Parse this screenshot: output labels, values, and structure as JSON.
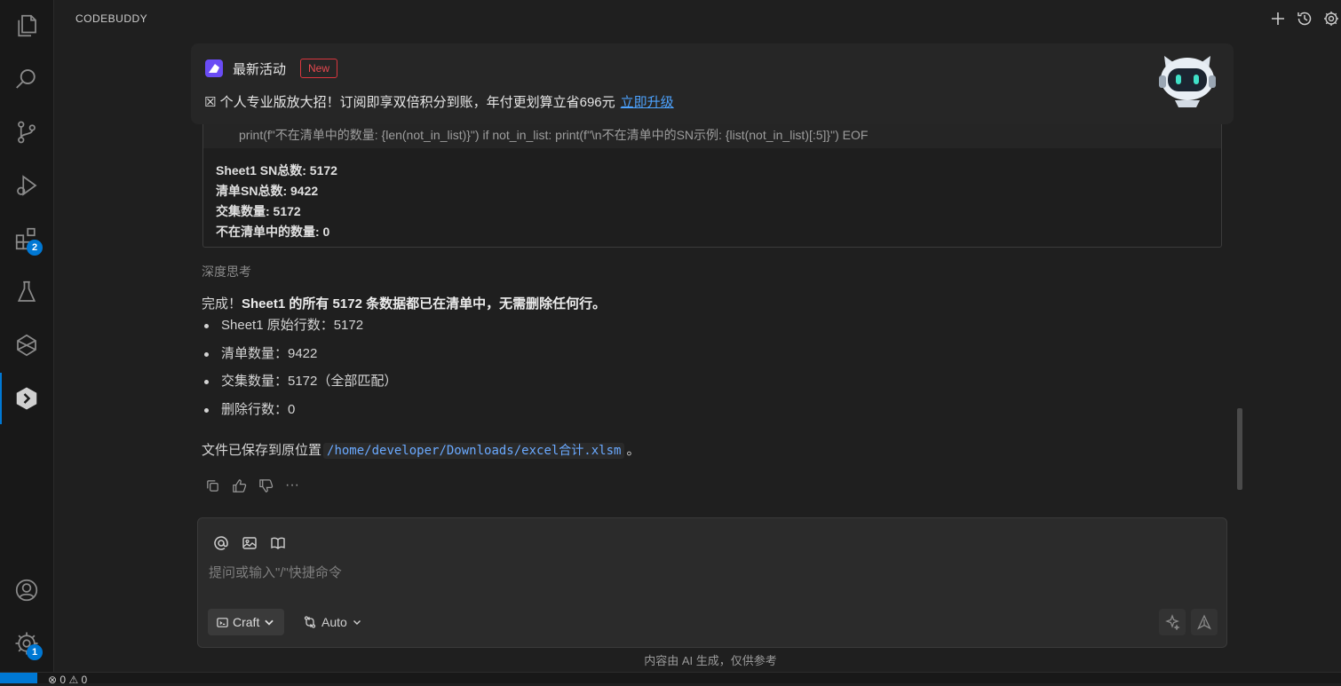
{
  "activity_bar": {
    "extensions_badge": "2",
    "settings_badge": "1"
  },
  "panel": {
    "title": "CODEBUDDY"
  },
  "promo": {
    "title": "最新活动",
    "badge": "New",
    "text": "☒ 个人专业版放大招！订阅即享双倍积分到账，年付更划算立省696元",
    "link": "立即升级"
  },
  "output": {
    "code_line": "print(f\"不在清单中的数量: {len(not_in_list)}\") if not_in_list: print(f\"\\n不在清单中的SN示例: {list(not_in_list)[:5]}\") EOF",
    "lines": [
      "Sheet1 SN总数: 5172",
      "清单SN总数: 9422",
      "交集数量: 5172",
      "不在清单中的数量: 0"
    ]
  },
  "message": {
    "thinking_label": "深度思考",
    "summary_prefix": "完成！",
    "summary_bold": "Sheet1 的所有 5172 条数据都已在清单中，无需删除任何行。",
    "bullets": [
      "Sheet1 原始行数：5172",
      "清单数量：9422",
      "交集数量：5172（全部匹配）",
      "删除行数：0"
    ],
    "saved_prefix": "文件已保存到原位置",
    "saved_path": "/home/developer/Downloads/excel合计.xlsm",
    "saved_suffix": "。",
    "more": "···"
  },
  "composer": {
    "placeholder": "提问或输入\"/\"快捷命令",
    "mode": "Craft",
    "model": "Auto"
  },
  "disclaimer": "内容由 AI 生成，仅供参考",
  "status": {
    "errors": "0",
    "warnings": "0"
  },
  "colors": {
    "accent": "#0078d4",
    "badge_red": "#d9363e",
    "link": "#4da3ff"
  }
}
